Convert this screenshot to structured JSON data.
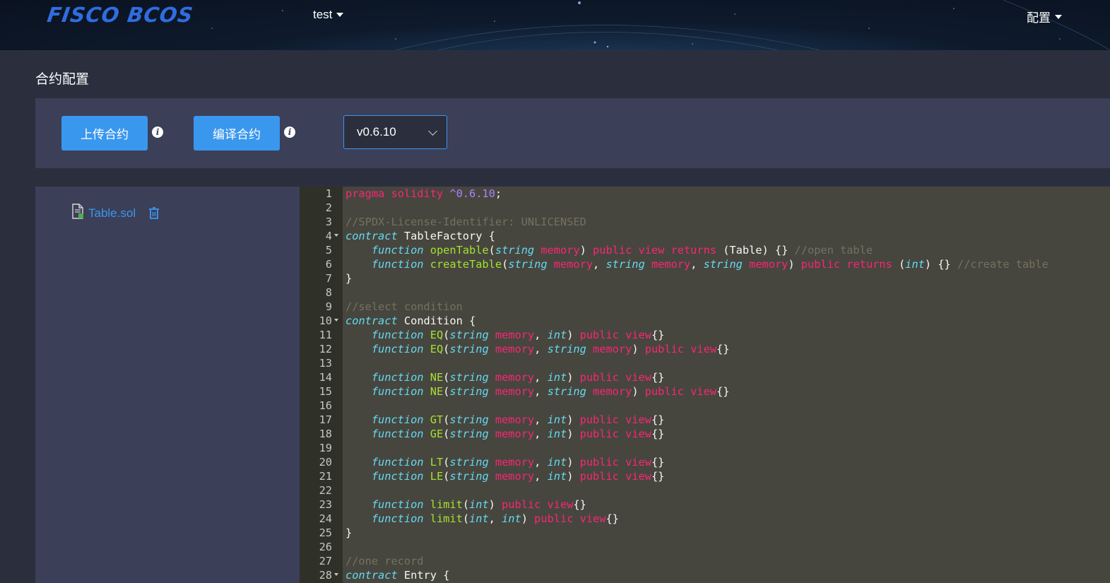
{
  "header": {
    "logo_text": "FISCO BCOS",
    "group": "test",
    "config_menu": "配置"
  },
  "page": {
    "title": "合约配置"
  },
  "toolbar": {
    "upload_label": "上传合约",
    "compile_label": "编译合约",
    "info_glyph": "i",
    "version": "v0.6.10"
  },
  "files": [
    {
      "name": "Table.sol"
    }
  ],
  "colors": {
    "accent": "#3a97ee",
    "panel": "#3b3f58",
    "background": "#2b2f3d",
    "editor_bg": "#46463f",
    "keyword": "#f92672",
    "type": "#66d9ef",
    "function_name": "#a6e22e",
    "comment": "#75715e",
    "number": "#ae81ff"
  },
  "editor": {
    "lines": [
      {
        "n": "1",
        "fold": false,
        "tokens": [
          [
            "kw",
            "pragma solidity "
          ],
          [
            "nm",
            "^0.6.10"
          ],
          [
            "p",
            ";"
          ]
        ]
      },
      {
        "n": "2",
        "fold": false,
        "tokens": []
      },
      {
        "n": "3",
        "fold": false,
        "tokens": [
          [
            "cm",
            "//SPDX-License-Identifier: UNLICENSED"
          ]
        ]
      },
      {
        "n": "4",
        "fold": true,
        "tokens": [
          [
            "ty",
            "contract"
          ],
          [
            "p",
            " TableFactory {"
          ]
        ]
      },
      {
        "n": "5",
        "fold": false,
        "tokens": [
          [
            "p",
            "    "
          ],
          [
            "ty",
            "function"
          ],
          [
            "p",
            " "
          ],
          [
            "fn",
            "openTable"
          ],
          [
            "p",
            "("
          ],
          [
            "ty",
            "string"
          ],
          [
            "p",
            " "
          ],
          [
            "kw",
            "memory"
          ],
          [
            "p",
            ") "
          ],
          [
            "kw",
            "public view returns"
          ],
          [
            "p",
            " (Table) {} "
          ],
          [
            "cm",
            "//open table"
          ]
        ]
      },
      {
        "n": "6",
        "fold": false,
        "tokens": [
          [
            "p",
            "    "
          ],
          [
            "ty",
            "function"
          ],
          [
            "p",
            " "
          ],
          [
            "fn",
            "createTable"
          ],
          [
            "p",
            "("
          ],
          [
            "ty",
            "string"
          ],
          [
            "p",
            " "
          ],
          [
            "kw",
            "memory"
          ],
          [
            "p",
            ", "
          ],
          [
            "ty",
            "string"
          ],
          [
            "p",
            " "
          ],
          [
            "kw",
            "memory"
          ],
          [
            "p",
            ", "
          ],
          [
            "ty",
            "string"
          ],
          [
            "p",
            " "
          ],
          [
            "kw",
            "memory"
          ],
          [
            "p",
            ") "
          ],
          [
            "kw",
            "public returns"
          ],
          [
            "p",
            " ("
          ],
          [
            "ty",
            "int"
          ],
          [
            "p",
            ") {} "
          ],
          [
            "cm",
            "//create table"
          ]
        ]
      },
      {
        "n": "7",
        "fold": false,
        "tokens": [
          [
            "p",
            "}"
          ]
        ]
      },
      {
        "n": "8",
        "fold": false,
        "tokens": []
      },
      {
        "n": "9",
        "fold": false,
        "tokens": [
          [
            "cm",
            "//select condition"
          ]
        ]
      },
      {
        "n": "10",
        "fold": true,
        "tokens": [
          [
            "ty",
            "contract"
          ],
          [
            "p",
            " Condition {"
          ]
        ]
      },
      {
        "n": "11",
        "fold": false,
        "tokens": [
          [
            "p",
            "    "
          ],
          [
            "ty",
            "function"
          ],
          [
            "p",
            " "
          ],
          [
            "fn",
            "EQ"
          ],
          [
            "p",
            "("
          ],
          [
            "ty",
            "string"
          ],
          [
            "p",
            " "
          ],
          [
            "kw",
            "memory"
          ],
          [
            "p",
            ", "
          ],
          [
            "ty",
            "int"
          ],
          [
            "p",
            ") "
          ],
          [
            "kw",
            "public view"
          ],
          [
            "p",
            "{}"
          ]
        ]
      },
      {
        "n": "12",
        "fold": false,
        "tokens": [
          [
            "p",
            "    "
          ],
          [
            "ty",
            "function"
          ],
          [
            "p",
            " "
          ],
          [
            "fn",
            "EQ"
          ],
          [
            "p",
            "("
          ],
          [
            "ty",
            "string"
          ],
          [
            "p",
            " "
          ],
          [
            "kw",
            "memory"
          ],
          [
            "p",
            ", "
          ],
          [
            "ty",
            "string"
          ],
          [
            "p",
            " "
          ],
          [
            "kw",
            "memory"
          ],
          [
            "p",
            ") "
          ],
          [
            "kw",
            "public view"
          ],
          [
            "p",
            "{}"
          ]
        ]
      },
      {
        "n": "13",
        "fold": false,
        "tokens": []
      },
      {
        "n": "14",
        "fold": false,
        "tokens": [
          [
            "p",
            "    "
          ],
          [
            "ty",
            "function"
          ],
          [
            "p",
            " "
          ],
          [
            "fn",
            "NE"
          ],
          [
            "p",
            "("
          ],
          [
            "ty",
            "string"
          ],
          [
            "p",
            " "
          ],
          [
            "kw",
            "memory"
          ],
          [
            "p",
            ", "
          ],
          [
            "ty",
            "int"
          ],
          [
            "p",
            ") "
          ],
          [
            "kw",
            "public view"
          ],
          [
            "p",
            "{}"
          ]
        ]
      },
      {
        "n": "15",
        "fold": false,
        "tokens": [
          [
            "p",
            "    "
          ],
          [
            "ty",
            "function"
          ],
          [
            "p",
            " "
          ],
          [
            "fn",
            "NE"
          ],
          [
            "p",
            "("
          ],
          [
            "ty",
            "string"
          ],
          [
            "p",
            " "
          ],
          [
            "kw",
            "memory"
          ],
          [
            "p",
            ", "
          ],
          [
            "ty",
            "string"
          ],
          [
            "p",
            " "
          ],
          [
            "kw",
            "memory"
          ],
          [
            "p",
            ") "
          ],
          [
            "kw",
            "public view"
          ],
          [
            "p",
            "{}"
          ]
        ]
      },
      {
        "n": "16",
        "fold": false,
        "tokens": []
      },
      {
        "n": "17",
        "fold": false,
        "tokens": [
          [
            "p",
            "    "
          ],
          [
            "ty",
            "function"
          ],
          [
            "p",
            " "
          ],
          [
            "fn",
            "GT"
          ],
          [
            "p",
            "("
          ],
          [
            "ty",
            "string"
          ],
          [
            "p",
            " "
          ],
          [
            "kw",
            "memory"
          ],
          [
            "p",
            ", "
          ],
          [
            "ty",
            "int"
          ],
          [
            "p",
            ") "
          ],
          [
            "kw",
            "public view"
          ],
          [
            "p",
            "{}"
          ]
        ]
      },
      {
        "n": "18",
        "fold": false,
        "tokens": [
          [
            "p",
            "    "
          ],
          [
            "ty",
            "function"
          ],
          [
            "p",
            " "
          ],
          [
            "fn",
            "GE"
          ],
          [
            "p",
            "("
          ],
          [
            "ty",
            "string"
          ],
          [
            "p",
            " "
          ],
          [
            "kw",
            "memory"
          ],
          [
            "p",
            ", "
          ],
          [
            "ty",
            "int"
          ],
          [
            "p",
            ") "
          ],
          [
            "kw",
            "public view"
          ],
          [
            "p",
            "{}"
          ]
        ]
      },
      {
        "n": "19",
        "fold": false,
        "tokens": []
      },
      {
        "n": "20",
        "fold": false,
        "tokens": [
          [
            "p",
            "    "
          ],
          [
            "ty",
            "function"
          ],
          [
            "p",
            " "
          ],
          [
            "fn",
            "LT"
          ],
          [
            "p",
            "("
          ],
          [
            "ty",
            "string"
          ],
          [
            "p",
            " "
          ],
          [
            "kw",
            "memory"
          ],
          [
            "p",
            ", "
          ],
          [
            "ty",
            "int"
          ],
          [
            "p",
            ") "
          ],
          [
            "kw",
            "public view"
          ],
          [
            "p",
            "{}"
          ]
        ]
      },
      {
        "n": "21",
        "fold": false,
        "tokens": [
          [
            "p",
            "    "
          ],
          [
            "ty",
            "function"
          ],
          [
            "p",
            " "
          ],
          [
            "fn",
            "LE"
          ],
          [
            "p",
            "("
          ],
          [
            "ty",
            "string"
          ],
          [
            "p",
            " "
          ],
          [
            "kw",
            "memory"
          ],
          [
            "p",
            ", "
          ],
          [
            "ty",
            "int"
          ],
          [
            "p",
            ") "
          ],
          [
            "kw",
            "public view"
          ],
          [
            "p",
            "{}"
          ]
        ]
      },
      {
        "n": "22",
        "fold": false,
        "tokens": []
      },
      {
        "n": "23",
        "fold": false,
        "tokens": [
          [
            "p",
            "    "
          ],
          [
            "ty",
            "function"
          ],
          [
            "p",
            " "
          ],
          [
            "fn",
            "limit"
          ],
          [
            "p",
            "("
          ],
          [
            "ty",
            "int"
          ],
          [
            "p",
            ") "
          ],
          [
            "kw",
            "public view"
          ],
          [
            "p",
            "{}"
          ]
        ]
      },
      {
        "n": "24",
        "fold": false,
        "tokens": [
          [
            "p",
            "    "
          ],
          [
            "ty",
            "function"
          ],
          [
            "p",
            " "
          ],
          [
            "fn",
            "limit"
          ],
          [
            "p",
            "("
          ],
          [
            "ty",
            "int"
          ],
          [
            "p",
            ", "
          ],
          [
            "ty",
            "int"
          ],
          [
            "p",
            ") "
          ],
          [
            "kw",
            "public view"
          ],
          [
            "p",
            "{}"
          ]
        ]
      },
      {
        "n": "25",
        "fold": false,
        "tokens": [
          [
            "p",
            "}"
          ]
        ]
      },
      {
        "n": "26",
        "fold": false,
        "tokens": []
      },
      {
        "n": "27",
        "fold": false,
        "tokens": [
          [
            "cm",
            "//one record"
          ]
        ]
      },
      {
        "n": "28",
        "fold": true,
        "tokens": [
          [
            "ty",
            "contract"
          ],
          [
            "p",
            " Entry {"
          ]
        ]
      }
    ]
  }
}
